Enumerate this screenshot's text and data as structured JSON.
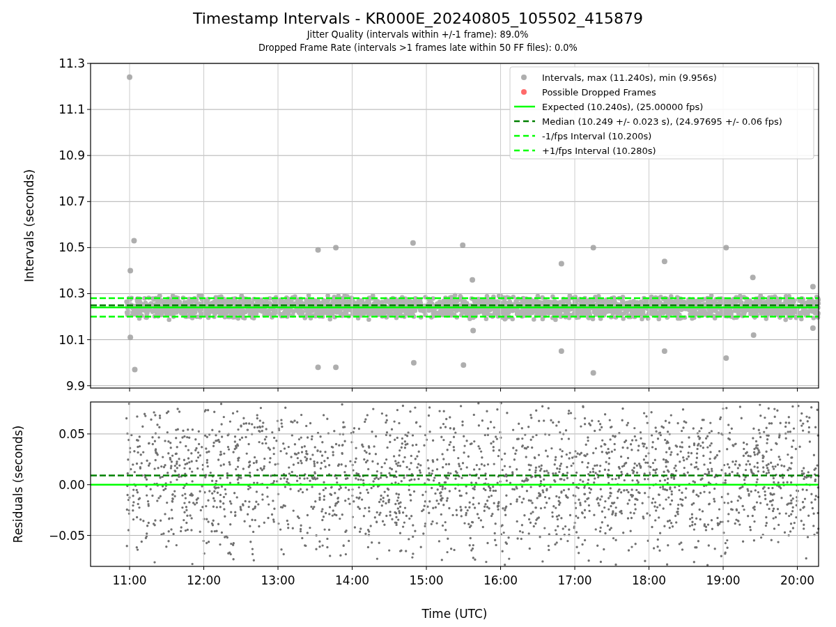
{
  "figure": {
    "title": "Timestamp Intervals - KR000E_20240805_105502_415879",
    "subtitles": [
      "Jitter Quality (intervals within +/-1 frame): 89.0%",
      "Dropped Frame Rate (intervals >1 frames late within 50 FF files): 0.0%"
    ],
    "xlabel": "Time (UTC)"
  },
  "panels": [
    {
      "chart_data": {
        "type": "scatter",
        "ylabel": "Intervals (seconds)",
        "grid": true,
        "legend": true,
        "xlim": [
          10.474,
          20.286
        ],
        "ylim": [
          9.89,
          11.3
        ],
        "yticks": [
          {
            "value": 9.9,
            "label": "9.9"
          },
          {
            "value": 10.1,
            "label": "10.1"
          },
          {
            "value": 10.3,
            "label": "10.3"
          },
          {
            "value": 10.5,
            "label": "10.5"
          },
          {
            "value": 10.7,
            "label": "10.7"
          },
          {
            "value": 10.9,
            "label": "10.9"
          },
          {
            "value": 11.1,
            "label": "11.1"
          },
          {
            "value": 11.3,
            "label": "11.3"
          }
        ],
        "x": [
          11.0,
          11.06,
          11.01,
          11.01,
          11.07,
          13.54,
          13.78,
          13.54,
          13.78,
          14.82,
          14.83,
          15.49,
          15.5,
          15.62,
          15.63,
          16.82,
          16.82,
          17.25,
          17.25,
          18.21,
          18.21,
          19.04,
          19.04,
          19.4,
          19.41,
          20.21,
          20.21
        ],
        "series": [
          {
            "name": "Intervals, max (11.240s), min (9.956s)",
            "color": "#a0a0a0",
            "values": [
              11.24,
              10.53,
              10.4,
              10.11,
              9.97,
              10.49,
              10.5,
              9.98,
              9.98,
              10.52,
              10.0,
              10.51,
              9.99,
              10.36,
              10.14,
              10.43,
              10.05,
              10.5,
              9.956,
              10.44,
              10.05,
              10.5,
              10.02,
              10.37,
              10.12,
              10.33,
              10.15
            ]
          },
          {
            "name": "Possible Dropped Frames",
            "color": "#ff5050",
            "values": [
              null,
              null,
              null,
              null,
              null,
              null,
              null,
              null,
              null,
              null,
              null,
              null,
              null,
              null,
              null,
              null,
              null,
              null,
              null,
              null,
              null,
              null,
              null,
              null,
              null,
              null,
              null
            ]
          }
        ],
        "ref_lines": [
          {
            "axis": "y",
            "value": 10.24,
            "label": "Expected (10.240s), (25.00000 fps)",
            "color": "#00ff00",
            "line_style": "solid"
          },
          {
            "axis": "y",
            "value": 10.249,
            "label": "Median (10.249 +/- 0.023 s), (24.97695 +/- 0.06 fps)",
            "color": "#008000",
            "line_style": "dashed"
          },
          {
            "axis": "y",
            "value": 10.2,
            "label": "-1/fps Interval (10.200s)",
            "color": "#00ff00",
            "line_style": "dashed"
          },
          {
            "axis": "y",
            "value": 10.28,
            "label": "+1/fps Interval (10.280s)",
            "color": "#00ff00",
            "line_style": "dashed"
          }
        ]
      }
    },
    {
      "chart_data": {
        "type": "scatter",
        "ylabel": "Residuals (seconds)",
        "grid": true,
        "xlim": [
          10.474,
          20.286
        ],
        "ylim": [
          -0.0805,
          0.0815
        ],
        "yticks": [
          {
            "value": -0.05,
            "label": "−0.05"
          },
          {
            "value": 0,
            "label": "0.00"
          },
          {
            "value": 0.05,
            "label": "0.05"
          }
        ],
        "xticks": [
          {
            "value": 11,
            "label": "11:00"
          },
          {
            "value": 12,
            "label": "12:00"
          },
          {
            "value": 13,
            "label": "13:00"
          },
          {
            "value": 14,
            "label": "14:00"
          },
          {
            "value": 15,
            "label": "15:00"
          },
          {
            "value": 16,
            "label": "16:00"
          },
          {
            "value": 17,
            "label": "17:00"
          },
          {
            "value": 18,
            "label": "18:00"
          },
          {
            "value": 19,
            "label": "19:00"
          },
          {
            "value": 20,
            "label": "20:00"
          }
        ],
        "ref_lines": [
          {
            "axis": "y",
            "value": 0,
            "color": "#00ff00",
            "line_style": "solid"
          },
          {
            "axis": "y",
            "value": 0.009,
            "color": "#008000",
            "line_style": "dashed"
          }
        ]
      }
    }
  ]
}
